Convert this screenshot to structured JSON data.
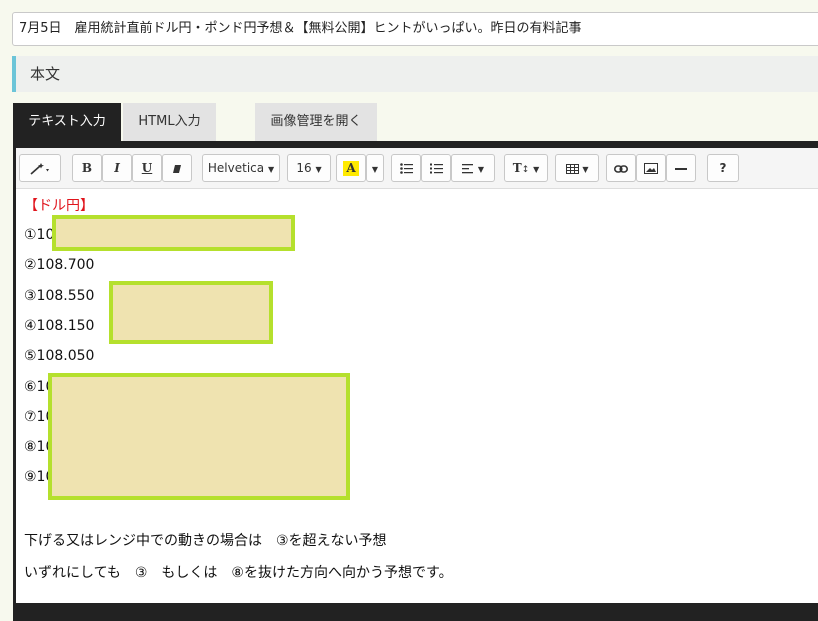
{
  "title_field": {
    "value": "7月5日　雇用統計直前ドル円・ポンド円予想＆【無料公開】ヒントがいっぱい。昨日の有料記事"
  },
  "section": {
    "heading": "本文"
  },
  "tabs": [
    {
      "label": "テキスト入力",
      "active": true
    },
    {
      "label": "HTML入力",
      "active": false
    },
    {
      "label": "画像管理を開く",
      "active": false
    }
  ],
  "toolbar": {
    "style_icon": "magic-wand-icon",
    "bold": "B",
    "italic": "I",
    "underline": "U",
    "eraser_icon": "eraser-icon",
    "font_name": "Helvetica",
    "font_size": "16",
    "color_label": "A",
    "unordered_list_icon": "unordered-list-icon",
    "ordered_list_icon": "ordered-list-icon",
    "align_icon": "align-left-icon",
    "text_height_label": "T",
    "table_icon": "table-icon",
    "link_icon": "link-icon",
    "image_icon": "image-icon",
    "hr_icon": "horizontal-rule-icon",
    "help": "?"
  },
  "content": {
    "heading": "【ドル円】",
    "lines": [
      "①10",
      "②108.700",
      "③108.550",
      "④108.150",
      "⑤108.050",
      "⑥10",
      "⑦10",
      "⑧10",
      "⑨10"
    ],
    "summary_1": "下げる又はレンジ中での動きの場合は　③を超えない予想",
    "summary_2": "いずれにしても　③　もしくは　⑧を抜けた方向へ向かう予想です。"
  },
  "colors": {
    "accent": "#6cc5d8",
    "heading_red": "#e0141c",
    "redaction_fill": "#efe3b0",
    "redaction_border": "#b5e02d"
  }
}
